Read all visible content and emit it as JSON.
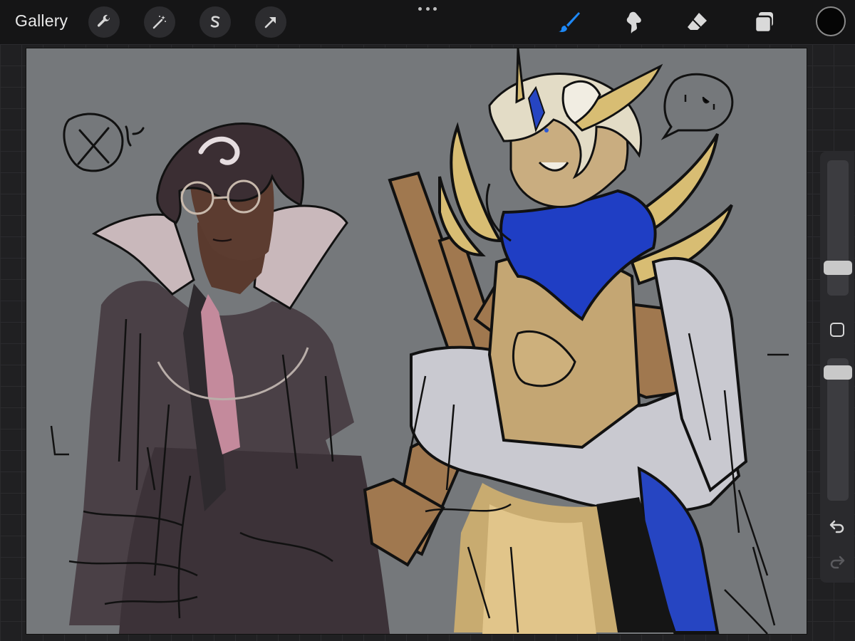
{
  "topbar": {
    "gallery_label": "Gallery",
    "left_tools": [
      "wrench-icon",
      "magic-wand-icon",
      "selection-s-icon",
      "transform-arrow-icon"
    ],
    "right_tools": [
      "brush-icon",
      "smudge-icon",
      "eraser-icon",
      "layers-icon"
    ],
    "active_tool": "brush-icon",
    "accent_color": "#1e88f5",
    "current_color": "#050505"
  },
  "sidebar": {
    "controls": [
      "brush-size-slider",
      "modify-button",
      "opacity-slider",
      "undo-icon",
      "redo-icon"
    ]
  },
  "canvas": {
    "background_color": "#75787b"
  }
}
